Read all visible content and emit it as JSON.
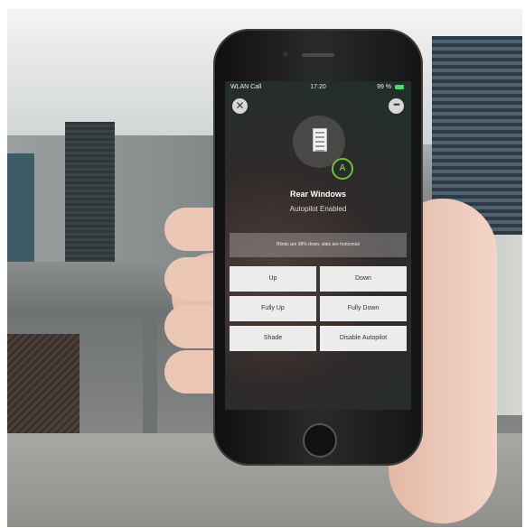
{
  "statusbar": {
    "carrier": "WLAN Call",
    "time": "17:20",
    "battery": "99 %"
  },
  "header": {
    "close_icon": "close-icon",
    "more_icon": "more-icon"
  },
  "device": {
    "icon": "window-blind-icon",
    "badge": "A",
    "title": "Rear Windows",
    "subtitle": "Autopilot Enabled",
    "status": "Blinds are 98% down, slats are horizontal"
  },
  "controls": {
    "up": "Up",
    "down": "Down",
    "fully_up": "Fully Up",
    "fully_down": "Fully Down",
    "shade": "Shade",
    "disable_autopilot": "Disable Autopilot"
  },
  "colors": {
    "accent": "#6cbf3a",
    "button_bg": "#ececec"
  }
}
